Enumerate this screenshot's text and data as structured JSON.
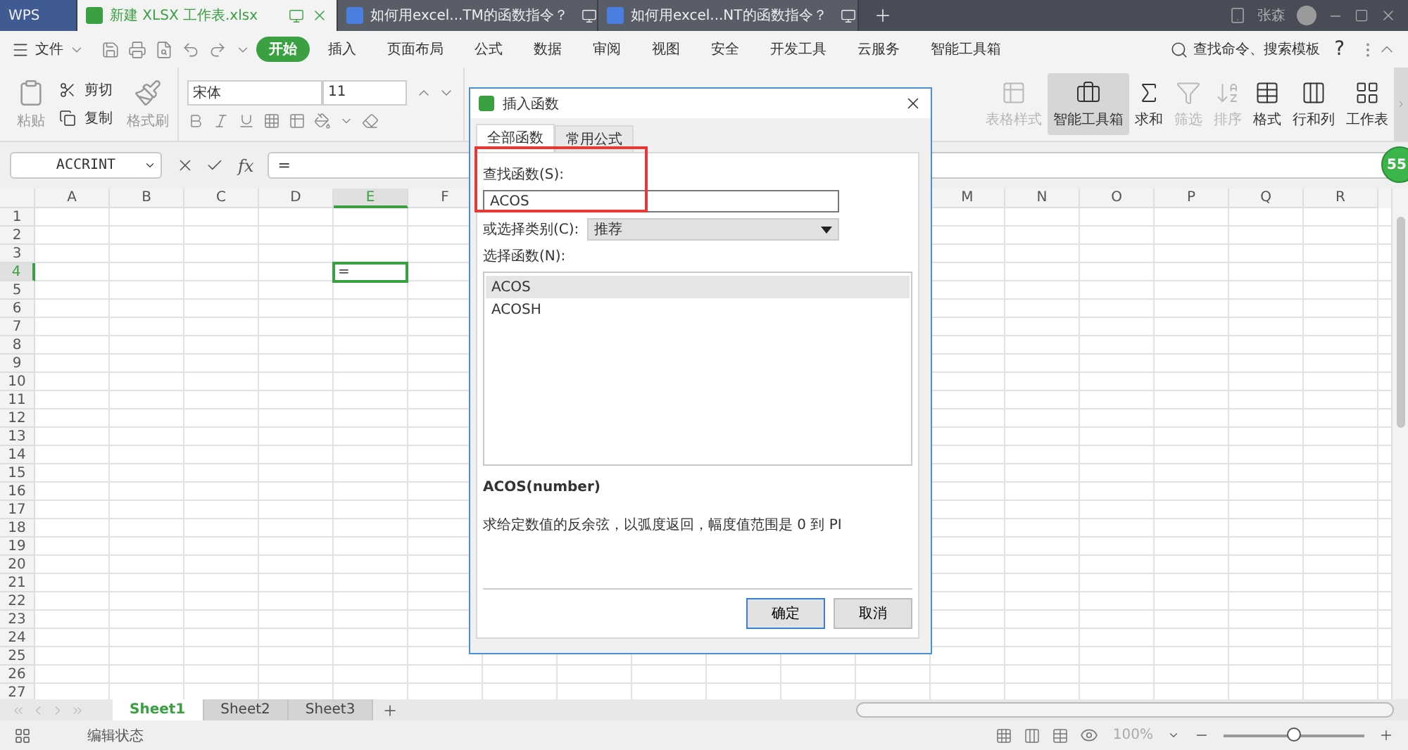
{
  "tabs": [
    {
      "label": "WPS",
      "kind": "home",
      "selected": false
    },
    {
      "label": "新建 XLSX 工作表.xlsx",
      "kind": "sheet",
      "selected": true
    },
    {
      "label": "如何用excel...TM的函数指令？",
      "kind": "doc",
      "selected": false
    },
    {
      "label": "如何用excel...NT的函数指令？",
      "kind": "doc",
      "selected": false
    }
  ],
  "user": {
    "name": "张森"
  },
  "menu": {
    "file": "文件",
    "items": [
      {
        "label": "开始",
        "selected": true
      },
      {
        "label": "插入",
        "selected": false
      },
      {
        "label": "页面布局",
        "selected": false
      },
      {
        "label": "公式",
        "selected": false
      },
      {
        "label": "数据",
        "selected": false
      },
      {
        "label": "审阅",
        "selected": false
      },
      {
        "label": "视图",
        "selected": false
      },
      {
        "label": "安全",
        "selected": false
      },
      {
        "label": "开发工具",
        "selected": false
      },
      {
        "label": "云服务",
        "selected": false
      },
      {
        "label": "智能工具箱",
        "selected": false
      }
    ],
    "search": "查找命令、搜索模板",
    "help": "?"
  },
  "ribbon": {
    "paste": "粘贴",
    "cut": "剪切",
    "copy": "复制",
    "format_painter": "格式刷",
    "font_name": "宋体",
    "font_size": "11",
    "tools": [
      {
        "label": "表格样式",
        "kind": "table-style",
        "disabled": true,
        "selected": false
      },
      {
        "label": "智能工具箱",
        "kind": "toolbox",
        "disabled": false,
        "selected": true
      },
      {
        "label": "求和",
        "kind": "sum",
        "disabled": false,
        "selected": false
      },
      {
        "label": "筛选",
        "kind": "filter",
        "disabled": true,
        "selected": false
      },
      {
        "label": "排序",
        "kind": "sort",
        "disabled": true,
        "selected": false
      },
      {
        "label": "格式",
        "kind": "format",
        "disabled": false,
        "selected": false
      },
      {
        "label": "行和列",
        "kind": "rows-cols",
        "disabled": false,
        "selected": false
      },
      {
        "label": "工作表",
        "kind": "sheet",
        "disabled": false,
        "selected": false
      }
    ]
  },
  "formula_bar": {
    "name_box": "ACCRINT",
    "fx": "fx",
    "value": "="
  },
  "floating_badge": "55",
  "sheet": {
    "columns_left": [
      {
        "label": "A",
        "selected": false
      },
      {
        "label": "B",
        "selected": false
      },
      {
        "label": "C",
        "selected": false
      },
      {
        "label": "D",
        "selected": false
      },
      {
        "label": "E",
        "selected": true
      },
      {
        "label": "F",
        "selected": false
      }
    ],
    "columns_right": [
      {
        "label": "M",
        "selected": false
      },
      {
        "label": "N",
        "selected": false
      },
      {
        "label": "O",
        "selected": false
      },
      {
        "label": "P",
        "selected": false
      },
      {
        "label": "Q",
        "selected": false
      },
      {
        "label": "R",
        "selected": false
      }
    ],
    "rows": [
      {
        "label": "1",
        "selected": false
      },
      {
        "label": "2",
        "selected": false
      },
      {
        "label": "3",
        "selected": false
      },
      {
        "label": "4",
        "selected": true
      },
      {
        "label": "5",
        "selected": false
      },
      {
        "label": "6",
        "selected": false
      },
      {
        "label": "7",
        "selected": false
      },
      {
        "label": "8",
        "selected": false
      },
      {
        "label": "9",
        "selected": false
      },
      {
        "label": "10",
        "selected": false
      },
      {
        "label": "11",
        "selected": false
      },
      {
        "label": "12",
        "selected": false
      },
      {
        "label": "13",
        "selected": false
      },
      {
        "label": "14",
        "selected": false
      },
      {
        "label": "15",
        "selected": false
      },
      {
        "label": "16",
        "selected": false
      },
      {
        "label": "17",
        "selected": false
      },
      {
        "label": "18",
        "selected": false
      },
      {
        "label": "19",
        "selected": false
      },
      {
        "label": "20",
        "selected": false
      },
      {
        "label": "21",
        "selected": false
      },
      {
        "label": "22",
        "selected": false
      },
      {
        "label": "23",
        "selected": false
      },
      {
        "label": "24",
        "selected": false
      },
      {
        "label": "25",
        "selected": false
      },
      {
        "label": "26",
        "selected": false
      },
      {
        "label": "27",
        "selected": false
      }
    ],
    "active_cell": {
      "value": "="
    }
  },
  "sheet_tabs": [
    {
      "label": "Sheet1",
      "selected": true
    },
    {
      "label": "Sheet2",
      "selected": false
    },
    {
      "label": "Sheet3",
      "selected": false
    }
  ],
  "status_bar": {
    "mode": "编辑状态",
    "zoom": "100%",
    "zoom_slider": {
      "level": 0.5
    }
  },
  "dialog": {
    "title": "插入函数",
    "tabs": [
      {
        "label": "全部函数",
        "selected": true
      },
      {
        "label": "常用公式",
        "selected": false
      }
    ],
    "search_label": "查找函数(S):",
    "search_value": "ACOS",
    "highlight": true,
    "category_label": "或选择类别(C):",
    "category_value": "推荐",
    "list_label": "选择函数(N):",
    "functions": [
      {
        "name": "ACOS",
        "selected": true
      },
      {
        "name": "ACOSH",
        "selected": false
      }
    ],
    "signature": "ACOS(number)",
    "description": "求给定数值的反余弦，以弧度返回，幅度值范围是 0 到 PI",
    "buttons": [
      {
        "label": "确定",
        "kind": "primary"
      },
      {
        "label": "取消",
        "kind": "secondary"
      }
    ]
  }
}
